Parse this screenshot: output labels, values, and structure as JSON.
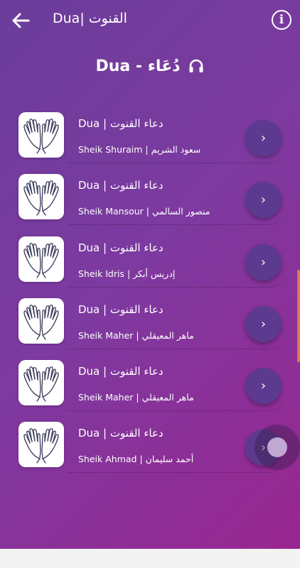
{
  "topbar": {
    "title": "القنوت |Dua"
  },
  "header": {
    "title": "Dua - دُعَاء"
  },
  "items": [
    {
      "title": "دعاء القنوت | Dua",
      "reciter": "Sheik Shuraim | سعود الشريم"
    },
    {
      "title": "دعاء القنوت | Dua",
      "reciter": "Sheik Mansour | منصور السالمي"
    },
    {
      "title": "دعاء القنوت | Dua",
      "reciter": "Sheik Idris | إدريس أبكر"
    },
    {
      "title": "دعاء القنوت | Dua",
      "reciter": "Sheik Maher | ماهر المعيقلي"
    },
    {
      "title": "دعاء القنوت | Dua",
      "reciter": "Sheik Maher | ماهر المعيقلي"
    },
    {
      "title": "دعاء القنوت | Dua",
      "reciter": "Sheik Ahmad | أحمد سليمان"
    }
  ],
  "icons": {
    "back": "arrow-left-icon",
    "info": "info-icon",
    "headphones": "headphones-icon",
    "go": "chevron-right-icon"
  },
  "colors": {
    "bg_start": "#6a3d9a",
    "bg_end": "#9b2590",
    "button": "#5b3a8f"
  }
}
